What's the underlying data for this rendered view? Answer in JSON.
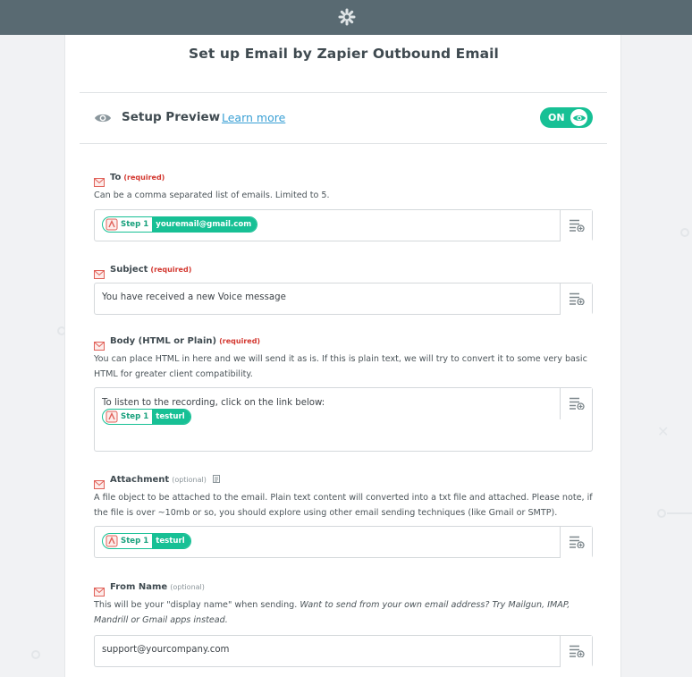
{
  "header": {
    "logo_icon": "zapier-asterisk-icon"
  },
  "page": {
    "title": "Set up Email by Zapier Outbound Email"
  },
  "preview": {
    "title": "Setup Preview",
    "learn_more": "Learn more",
    "toggle_label": "ON",
    "toggle_color": "#17c095"
  },
  "fields": {
    "to": {
      "label": "To",
      "tag": "(required)",
      "help": "Can be a comma separated list of emails. Limited to 5.",
      "pill_step": "Step 1",
      "pill_value": "youremail@gmail.com"
    },
    "subject": {
      "label": "Subject",
      "tag": "(required)",
      "value": "You have received a new Voice message"
    },
    "body": {
      "label": "Body (HTML or Plain)",
      "tag": "(required)",
      "help": "You can place HTML in here and we will send it as is. If this is plain text, we will try to convert it to some very basic HTML for greater client compatibility.",
      "text": "To listen to the recording, click on the link below:",
      "pill_step": "Step 1",
      "pill_value": "testurl"
    },
    "attachment": {
      "label": "Attachment",
      "tag": "(optional)",
      "help": "A file object to be attached to the email. Plain text content will converted into a txt file and attached. Please note, if the file is over ~10mb or so, you should explore using other email sending techniques (like Gmail or SMTP).",
      "pill_step": "Step 1",
      "pill_value": "testurl"
    },
    "from_name": {
      "label": "From Name",
      "tag": "(optional)",
      "help": "This will be your \"display name\" when sending.",
      "help_italic": "Want to send from your own email address? Try Mailgun, IMAP, Mandrill or Gmail apps instead.",
      "value": "support@yourcompany.com"
    }
  },
  "colors": {
    "accent": "#17c095",
    "required": "#d3372f",
    "link": "#3aa0d5",
    "topbar": "#596a72"
  }
}
